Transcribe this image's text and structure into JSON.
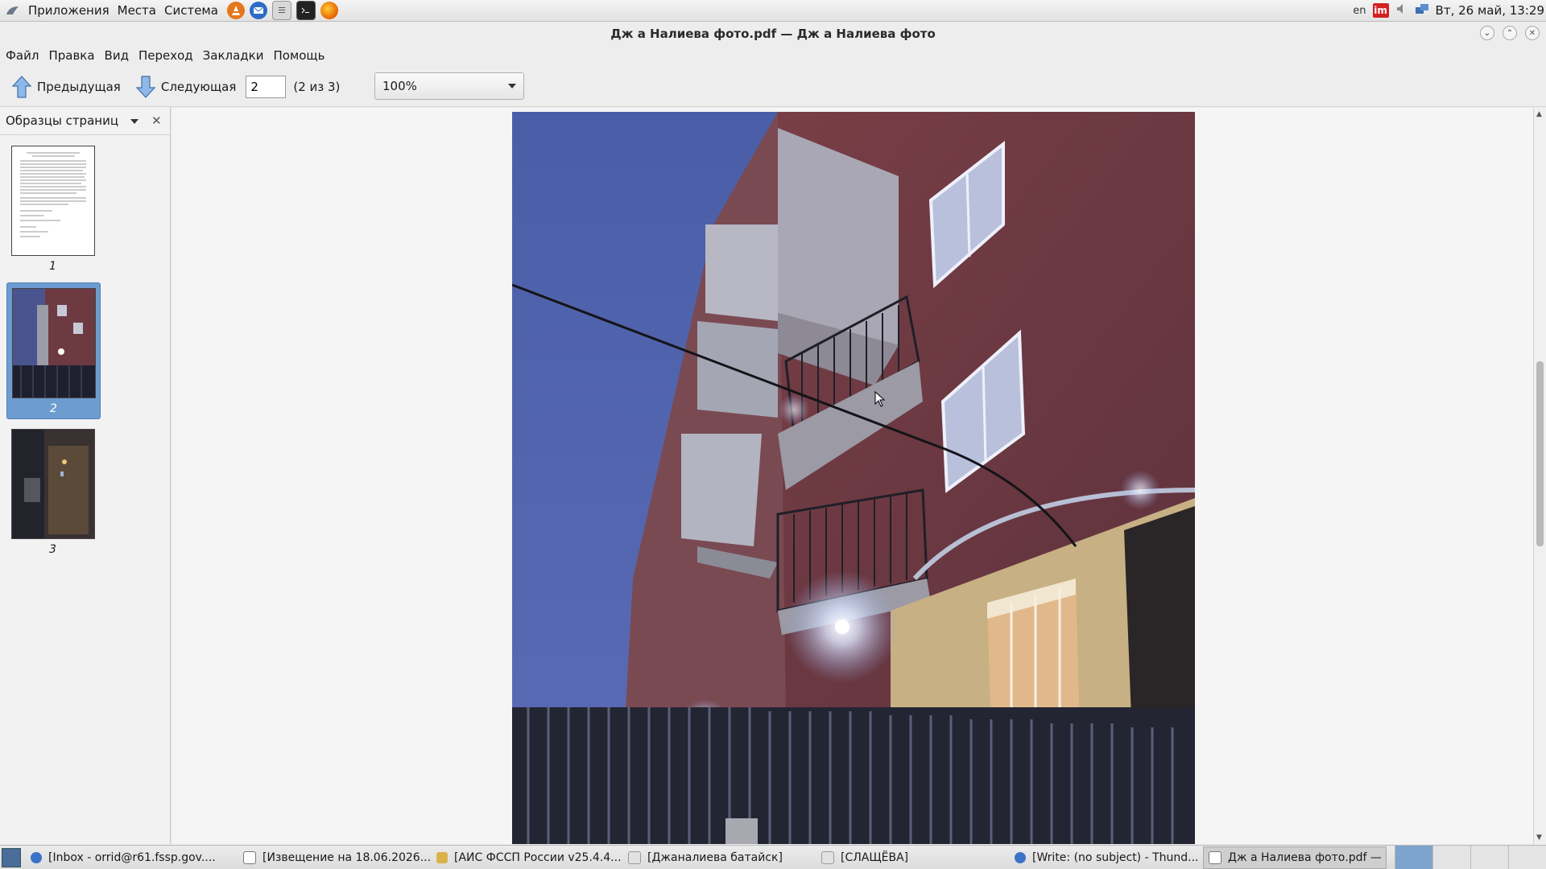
{
  "top_panel": {
    "menus": [
      "Приложения",
      "Места",
      "Система"
    ],
    "launchers": [
      "vlc-icon",
      "thunderbird-icon",
      "text-editor-icon",
      "terminal-icon",
      "firefox-icon"
    ],
    "lang": "en",
    "im_label": "im",
    "clock": "Вт, 26 май, 13:29"
  },
  "window": {
    "title": "Дж а Налиева фото.pdf — Дж а Налиева фото"
  },
  "menubar": [
    "Файл",
    "Правка",
    "Вид",
    "Переход",
    "Закладки",
    "Помощь"
  ],
  "toolbar": {
    "prev_label": "Предыдущая",
    "next_label": "Следующая",
    "page_value": "2",
    "page_count": "(2 из 3)",
    "zoom": "100%"
  },
  "sidebar": {
    "title": "Образцы страниц",
    "thumbnails": [
      {
        "label": "1",
        "selected": false
      },
      {
        "label": "2",
        "selected": true
      },
      {
        "label": "3",
        "selected": false
      }
    ]
  },
  "taskbar": {
    "tasks": [
      {
        "label": "[Inbox - orrid@r61.fssp.gov....",
        "icon": "thunderbird-icon",
        "active": false
      },
      {
        "label": "[Извещение на 18.06.2026...",
        "icon": "document-icon",
        "active": false
      },
      {
        "label": "[АИС ФССП России v25.4.4...",
        "icon": "emblem-icon",
        "active": false
      },
      {
        "label": "[Джаналиева батайск]",
        "icon": "folder-icon",
        "active": false
      },
      {
        "label": "[СЛАЩЁВА]",
        "icon": "folder-icon",
        "active": false
      },
      {
        "label": "[Write: (no subject) - Thund...",
        "icon": "thunderbird-icon",
        "active": false
      },
      {
        "label": "Дж а Налиева фото.pdf — ...",
        "icon": "pdf-icon",
        "active": true
      }
    ],
    "workspaces": 4
  },
  "colors": {
    "selection": "#6d9dd0",
    "photo_sky": "#4a5590",
    "brick": "#7a3f46"
  }
}
